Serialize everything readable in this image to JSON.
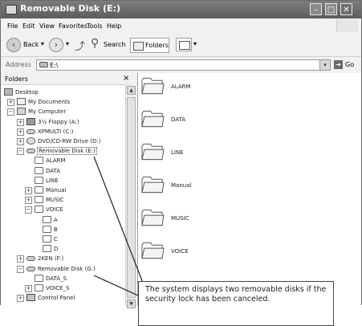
{
  "window": {
    "title": "Removable Disk (E:)",
    "buttons": [
      "minimize",
      "maximize",
      "close"
    ]
  },
  "menubar": {
    "items": [
      "File",
      "Edit",
      "View",
      "Favorites",
      "Tools",
      "Help"
    ]
  },
  "toolbar": {
    "back_label": "Back",
    "search_label": "Search",
    "folders_label": "Folders"
  },
  "addressbar": {
    "label": "Address",
    "value": "E:\\",
    "go_label": "Go"
  },
  "folders_pane": {
    "title": "Folders",
    "close_glyph": "×"
  },
  "tree": [
    {
      "label": "Desktop",
      "icon": "desktop-icon",
      "expander": "",
      "depth": 0
    },
    {
      "label": "My Documents",
      "icon": "documents-icon",
      "expander": "+",
      "depth": 1
    },
    {
      "label": "My Computer",
      "icon": "computer-icon",
      "expander": "−",
      "depth": 1
    },
    {
      "label": "3½ Floppy (A:)",
      "icon": "floppy-icon",
      "expander": "+",
      "depth": 2
    },
    {
      "label": "XPMULTI (C:)",
      "icon": "drive-icon",
      "expander": "+",
      "depth": 2
    },
    {
      "label": "DVD/CD-RW Drive (D:)",
      "icon": "cd-drive-icon",
      "expander": "+",
      "depth": 2
    },
    {
      "label": "Removable Disk (E:)",
      "icon": "drive-icon",
      "expander": "−",
      "depth": 2,
      "selected": true
    },
    {
      "label": "ALARM",
      "icon": "folder-icon",
      "expander": "",
      "depth": 3
    },
    {
      "label": "DATA",
      "icon": "folder-icon",
      "expander": "",
      "depth": 3
    },
    {
      "label": "LINE",
      "icon": "folder-icon",
      "expander": "",
      "depth": 3
    },
    {
      "label": "Manual",
      "icon": "folder-icon",
      "expander": "+",
      "depth": 3
    },
    {
      "label": "MUSIC",
      "icon": "folder-icon",
      "expander": "+",
      "depth": 3
    },
    {
      "label": "VOICE",
      "icon": "folder-icon",
      "expander": "−",
      "depth": 3
    },
    {
      "label": "A",
      "icon": "folder-icon",
      "expander": "",
      "depth": 4
    },
    {
      "label": "B",
      "icon": "folder-icon",
      "expander": "",
      "depth": 4
    },
    {
      "label": "C",
      "icon": "folder-icon",
      "expander": "",
      "depth": 4
    },
    {
      "label": "D",
      "icon": "folder-icon",
      "expander": "",
      "depth": 4
    },
    {
      "label": "2KEN (F:)",
      "icon": "drive-icon",
      "expander": "+",
      "depth": 2
    },
    {
      "label": "Removable Disk (G:)",
      "icon": "drive-icon",
      "expander": "−",
      "depth": 2
    },
    {
      "label": "DATA_S",
      "icon": "folder-icon",
      "expander": "",
      "depth": 3
    },
    {
      "label": "VOICE_S",
      "icon": "folder-icon",
      "expander": "+",
      "depth": 3
    },
    {
      "label": "Control Panel",
      "icon": "control-panel-icon",
      "expander": "+",
      "depth": 2
    }
  ],
  "content_items": [
    {
      "label": "ALARM"
    },
    {
      "label": "DATA"
    },
    {
      "label": "LINE"
    },
    {
      "label": "Manual"
    },
    {
      "label": "MUSIC"
    },
    {
      "label": "VOICE"
    }
  ],
  "callout": {
    "text": "The system displays two removable disks if the security lock has been canceled."
  }
}
